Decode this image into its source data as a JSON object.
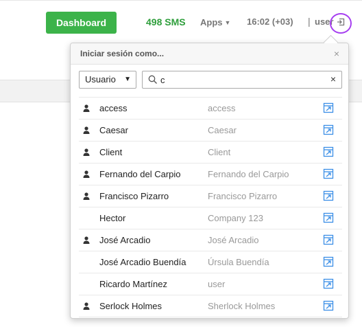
{
  "header": {
    "dashboard_label": "Dashboard",
    "sms_label": "498 SMS",
    "apps_label": "Apps",
    "clock": "16:02 (+03)",
    "separator": "|",
    "user": "user"
  },
  "panel": {
    "title": "Iniciar sesión como...",
    "close": "×",
    "type_select": "Usuario",
    "search_value": "c",
    "clear": "×"
  },
  "users": [
    {
      "name": "access",
      "alias": "access",
      "has_person_icon": true
    },
    {
      "name": "Caesar",
      "alias": "Caesar",
      "has_person_icon": true
    },
    {
      "name": "Client",
      "alias": "Client",
      "has_person_icon": true
    },
    {
      "name": "Fernando del Carpio",
      "alias": "Fernando del Carpio",
      "has_person_icon": true
    },
    {
      "name": "Francisco Pizarro",
      "alias": "Francisco Pizarro",
      "has_person_icon": true
    },
    {
      "name": "Hector",
      "alias": "Company 123",
      "has_person_icon": false
    },
    {
      "name": "José Arcadio",
      "alias": "José Arcadio",
      "has_person_icon": true
    },
    {
      "name": "José Arcadio Buendía",
      "alias": "Úrsula Buendía",
      "has_person_icon": false
    },
    {
      "name": "Ricardo Martínez",
      "alias": "user",
      "has_person_icon": false
    },
    {
      "name": "Serlock Holmes",
      "alias": "Sherlock Holmes",
      "has_person_icon": true
    }
  ],
  "colors": {
    "dashboard_bg": "#3cb34a",
    "sms_text": "#2e9e3b",
    "cursor_ring": "#a63ff0",
    "login_icon": "#3a8ee6"
  }
}
